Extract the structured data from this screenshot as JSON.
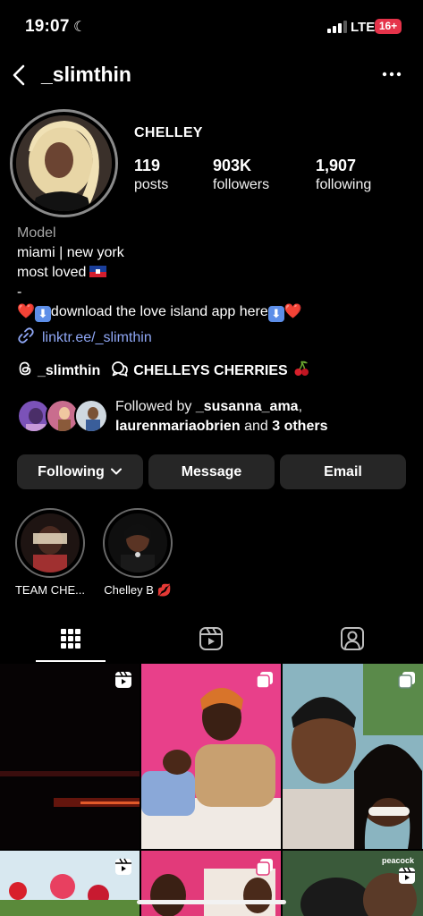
{
  "status_bar": {
    "time": "19:07",
    "network": "LTE",
    "battery": "16+"
  },
  "header": {
    "username": "_slimthin"
  },
  "profile": {
    "display_name": "CHELLEY",
    "stats": [
      {
        "value": "119",
        "label": "posts"
      },
      {
        "value": "903K",
        "label": "followers"
      },
      {
        "value": "1,907",
        "label": "following"
      }
    ],
    "bio": {
      "category": "Model",
      "line1": "miami | new york",
      "line2": "most loved",
      "line3": "-",
      "line4": "download the love island app here"
    },
    "link": "linktr.ee/_slimthin",
    "threads_handle": "_slimthin",
    "channel_name": "CHELLEYS CHERRIES",
    "followed_by": {
      "prefix": "Followed by",
      "user1": "_susanna_ama",
      "user2": "laurenmariaobrien",
      "and": "and",
      "others": "3 others"
    }
  },
  "buttons": {
    "following": "Following",
    "message": "Message",
    "email": "Email"
  },
  "highlights": [
    {
      "label": "TEAM CHE..."
    },
    {
      "label": "Chelley B"
    }
  ],
  "grid": {
    "peacock_label": "peacock"
  },
  "colors": {
    "background": "#000000",
    "button_bg": "#262626",
    "link": "#8fa7f5",
    "secondary_text": "#a8a8a8",
    "battery_badge": "#e5334a"
  }
}
